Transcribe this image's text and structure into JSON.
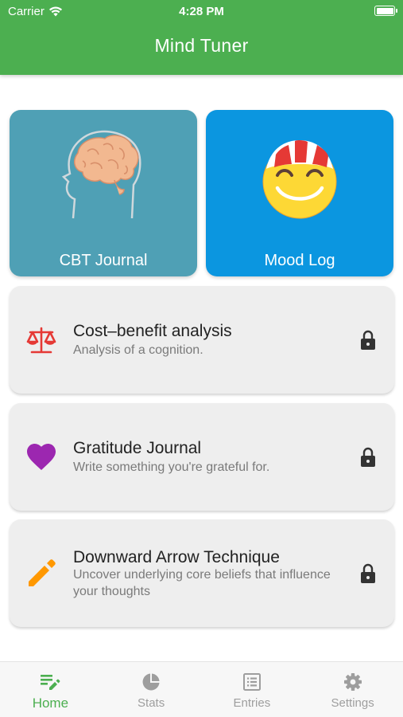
{
  "status_bar": {
    "carrier": "Carrier",
    "time": "4:28 PM"
  },
  "app": {
    "title": "Mind Tuner"
  },
  "tiles": [
    {
      "label": "CBT Journal",
      "icon": "brain-head-icon",
      "color": "#4fa0b5"
    },
    {
      "label": "Mood Log",
      "icon": "smiley-face-icon",
      "color": "#0b96e0"
    }
  ],
  "cards": [
    {
      "title": "Cost–benefit analysis",
      "subtitle": "Analysis of a cognition.",
      "icon": "scales-icon",
      "icon_color": "#e53935",
      "locked": true
    },
    {
      "title": "Gratitude Journal",
      "subtitle": "Write something you're grateful for.",
      "icon": "heart-icon",
      "icon_color": "#9c27b0",
      "locked": true
    },
    {
      "title": "Downward Arrow Technique",
      "subtitle": "Uncover underlying core beliefs that influence your thoughts",
      "icon": "pencil-icon",
      "icon_color": "#ff9800",
      "locked": true
    }
  ],
  "tabbar": {
    "active": "Home",
    "accent": "#4caf50",
    "items": [
      {
        "label": "Home",
        "icon": "journal-edit-icon"
      },
      {
        "label": "Stats",
        "icon": "pie-chart-icon"
      },
      {
        "label": "Entries",
        "icon": "list-icon"
      },
      {
        "label": "Settings",
        "icon": "gear-icon"
      }
    ]
  }
}
